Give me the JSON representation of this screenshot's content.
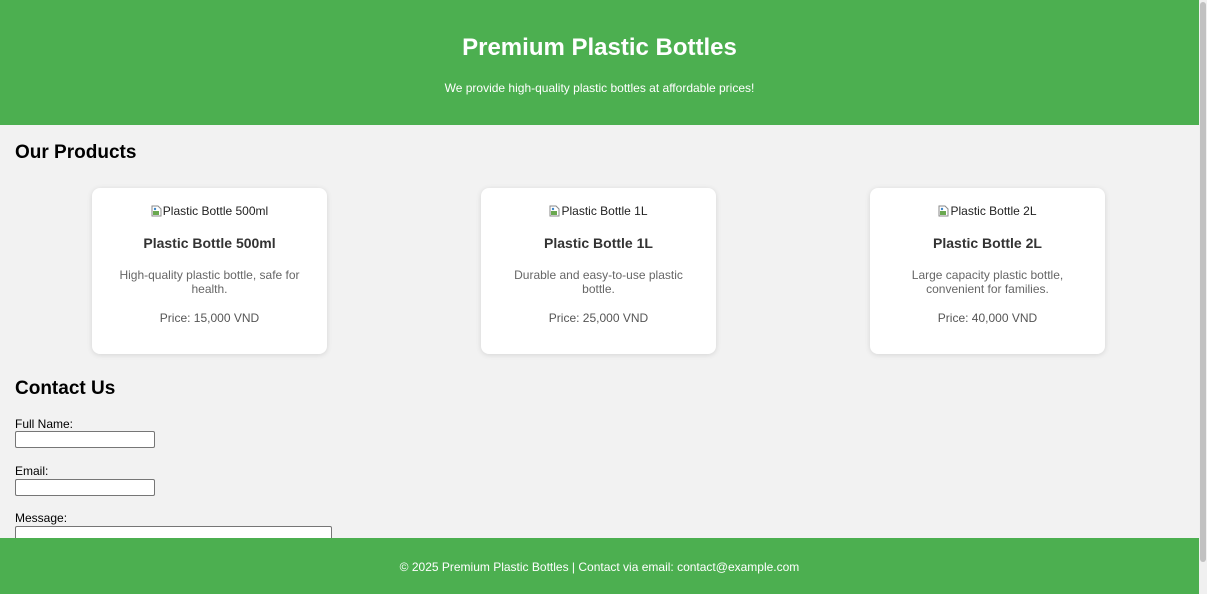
{
  "header": {
    "title": "Premium Plastic Bottles",
    "tagline": "We provide high-quality plastic bottles at affordable prices!"
  },
  "products": {
    "heading": "Our Products",
    "items": [
      {
        "image_alt": "Plastic Bottle 500ml",
        "name": "Plastic Bottle 500ml",
        "description": "High-quality plastic bottle, safe for health.",
        "price": "Price: 15,000 VND"
      },
      {
        "image_alt": "Plastic Bottle 1L",
        "name": "Plastic Bottle 1L",
        "description": "Durable and easy-to-use plastic bottle.",
        "price": "Price: 25,000 VND"
      },
      {
        "image_alt": "Plastic Bottle 2L",
        "name": "Plastic Bottle 2L",
        "description": "Large capacity plastic bottle, convenient for families.",
        "price": "Price: 40,000 VND"
      }
    ]
  },
  "contact": {
    "heading": "Contact Us",
    "name_label": "Full Name:",
    "name_value": "",
    "email_label": "Email:",
    "email_value": "",
    "message_label": "Message:",
    "message_value": ""
  },
  "footer": {
    "text": "© 2025 Premium Plastic Bottles | Contact via email: contact@example.com"
  },
  "colors": {
    "brand_green": "#4caf50",
    "page_background": "#f2f2f2",
    "card_background": "#ffffff"
  },
  "icons": {
    "product_image": "broken-image-icon"
  }
}
